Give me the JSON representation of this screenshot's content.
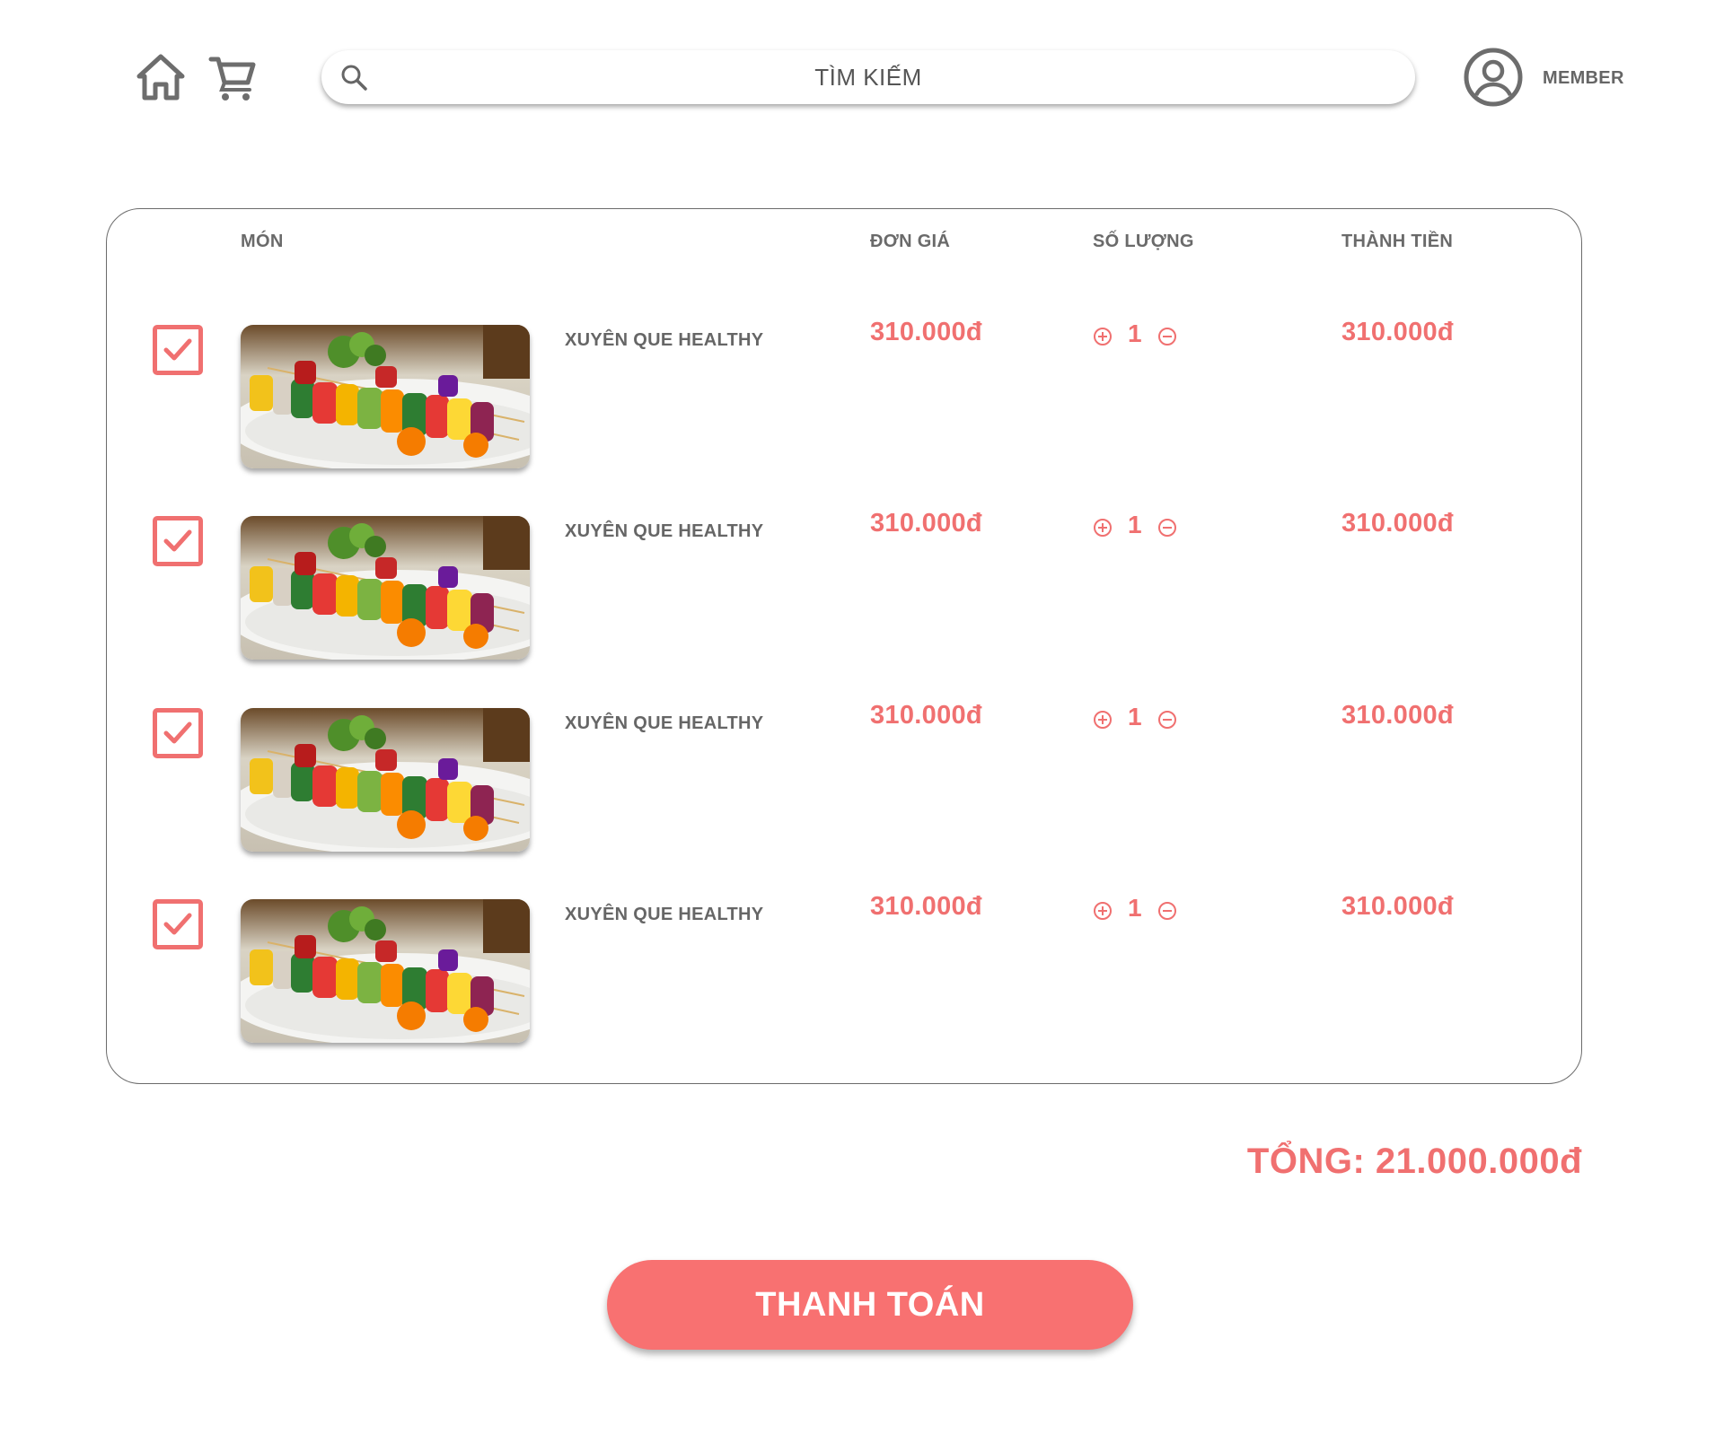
{
  "header": {
    "home_icon": "home-icon",
    "cart_icon": "cart-icon",
    "search": {
      "placeholder": "TÌM KIẾM",
      "value": ""
    },
    "avatar_icon": "user-circle-icon",
    "member_label": "MEMBER"
  },
  "columns": {
    "item": "MÓN",
    "unit_price": "ĐƠN GIÁ",
    "quantity": "SỐ LƯỢNG",
    "subtotal": "THÀNH TIỀN"
  },
  "items": [
    {
      "checked": true,
      "name": "XUYÊN QUE HEALTHY",
      "unit_price": "310.000đ",
      "quantity": "1",
      "subtotal": "310.000đ"
    },
    {
      "checked": true,
      "name": "XUYÊN QUE HEALTHY",
      "unit_price": "310.000đ",
      "quantity": "1",
      "subtotal": "310.000đ"
    },
    {
      "checked": true,
      "name": "XUYÊN QUE HEALTHY",
      "unit_price": "310.000đ",
      "quantity": "1",
      "subtotal": "310.000đ"
    },
    {
      "checked": true,
      "name": "XUYÊN QUE HEALTHY",
      "unit_price": "310.000đ",
      "quantity": "1",
      "subtotal": "310.000đ"
    }
  ],
  "total": "TỔNG: 21.000.000đ",
  "checkout_label": "THANH TOÁN",
  "colors": {
    "accent": "#f07070",
    "button": "#f87171",
    "text": "#666666"
  }
}
